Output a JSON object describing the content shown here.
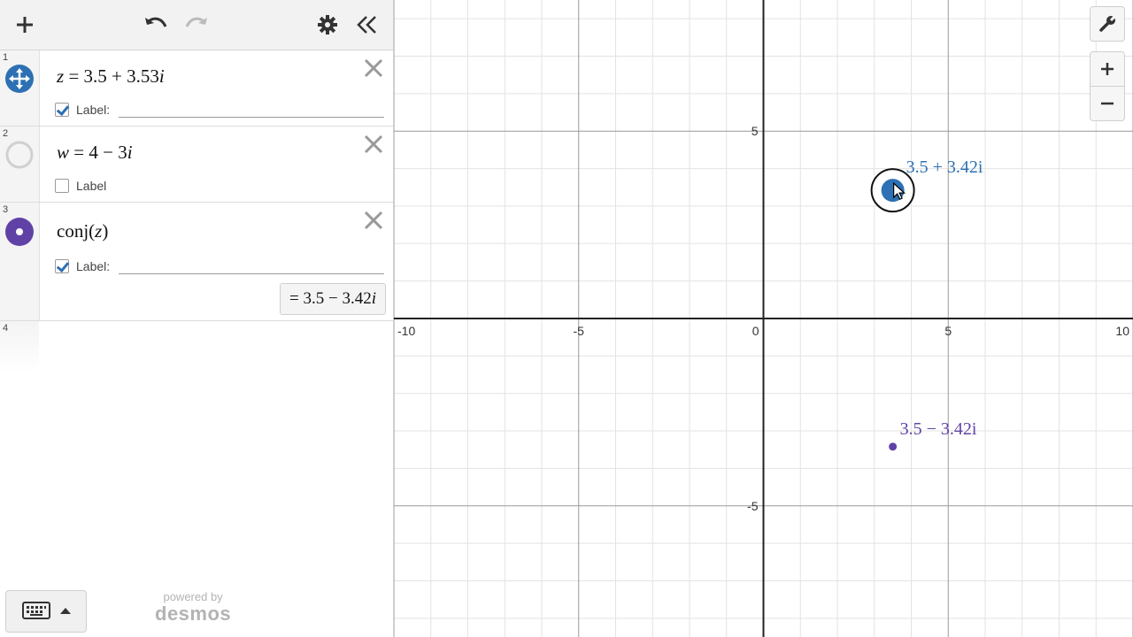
{
  "expressions": [
    {
      "index": "1",
      "lhs": "z",
      "rhs_a": "3.5",
      "rhs_op": "+",
      "rhs_b": "3.53",
      "imag": "i",
      "label_text": "Label:",
      "label_checked": true,
      "color": "#2d70b3"
    },
    {
      "index": "2",
      "lhs": "w",
      "rhs_a": "4",
      "rhs_op": "−",
      "rhs_b": "3",
      "imag": "i",
      "label_text": "Label",
      "label_checked": false,
      "color": "#c7c7c7"
    },
    {
      "index": "3",
      "fn": "conj",
      "arg": "z",
      "label_text": "Label:",
      "label_checked": true,
      "result_prefix": "=",
      "result_a": "3.5",
      "result_op": "−",
      "result_b": "3.42",
      "result_imag": "i",
      "color": "#6042a6"
    },
    {
      "index": "4"
    }
  ],
  "branding": {
    "line1": "powered by",
    "line2": "desmos"
  },
  "graph": {
    "xlim": [
      -10,
      10
    ],
    "ylim": [
      -8.5,
      8.5
    ],
    "x_ticks": [
      "-10",
      "-5",
      "0",
      "5",
      "10"
    ],
    "y_ticks": [
      "5",
      "-5"
    ],
    "points": [
      {
        "x": 3.5,
        "y": 3.42,
        "label": "3.5 + 3.42i",
        "color": "#2d70b3",
        "selected": true
      },
      {
        "x": 3.5,
        "y": -3.42,
        "label": "3.5 − 3.42i",
        "color": "#6042a6",
        "selected": false
      }
    ]
  },
  "icons": {
    "add": "plus-icon",
    "undo": "undo-icon",
    "redo": "redo-icon",
    "settings": "gear-icon",
    "collapse": "double-chevron-left-icon",
    "wrench": "wrench-icon",
    "zoom_in": "plus-icon",
    "zoom_out": "minus-icon",
    "keyboard": "keyboard-icon",
    "close": "close-icon",
    "drag": "move-arrows-icon"
  }
}
